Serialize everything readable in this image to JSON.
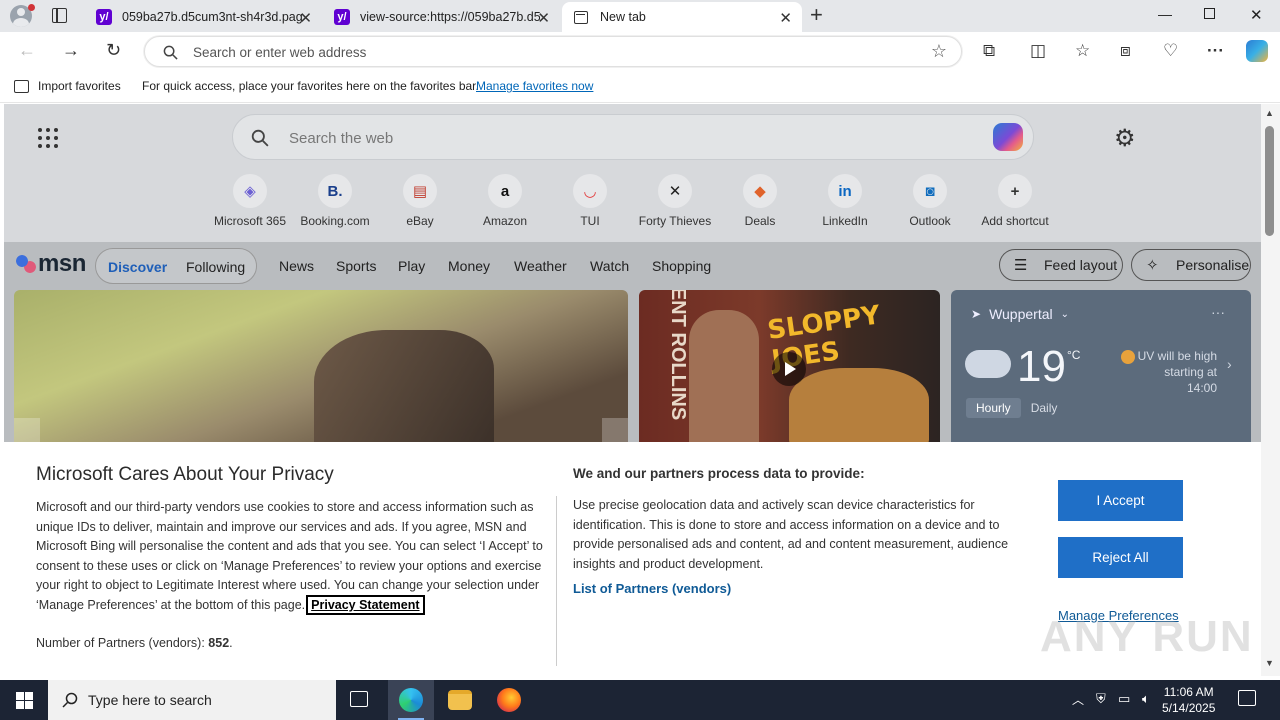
{
  "tabs": [
    {
      "title": "059ba27b.d5cum3nt-sh4r3d.pag"
    },
    {
      "title": "view-source:https://059ba27b.d5"
    },
    {
      "title": "New tab"
    }
  ],
  "address": {
    "placeholder": "Search or enter web address"
  },
  "favbar": {
    "import_label": "Import favorites",
    "message": "For quick access, place your favorites here on the favorites bar.",
    "manage_link": "Manage favorites now"
  },
  "newtab": {
    "search_placeholder": "Search the web",
    "shortcuts": [
      {
        "label": "Microsoft 365",
        "icon": "microsoft-365-icon",
        "glyph": "◈",
        "color": "#6b5fd3"
      },
      {
        "label": "Booking.com",
        "icon": "booking-icon",
        "glyph": "B.",
        "color": "#1a3f8c"
      },
      {
        "label": "eBay",
        "icon": "ebay-icon",
        "glyph": "▤",
        "color": "#c0392b"
      },
      {
        "label": "Amazon",
        "icon": "amazon-icon",
        "glyph": "a",
        "color": "#111111"
      },
      {
        "label": "TUI",
        "icon": "tui-icon",
        "glyph": "◡",
        "color": "#e23a3a"
      },
      {
        "label": "Forty Thieves",
        "icon": "forty-thieves-icon",
        "glyph": "✕",
        "color": "#222222"
      },
      {
        "label": "Deals",
        "icon": "deals-icon",
        "glyph": "◆",
        "color": "#e0632b"
      },
      {
        "label": "LinkedIn",
        "icon": "linkedin-icon",
        "glyph": "in",
        "color": "#0a66c2"
      },
      {
        "label": "Outlook",
        "icon": "outlook-icon",
        "glyph": "◙",
        "color": "#0f6cbd"
      },
      {
        "label": "Add shortcut",
        "icon": "plus-icon",
        "glyph": "+",
        "color": "#333333"
      }
    ],
    "msn_logo": "msn",
    "pill_tabs": [
      "Discover",
      "Following"
    ],
    "nav_items": [
      "News",
      "Sports",
      "Play",
      "Money",
      "Weather",
      "Watch",
      "Shopping"
    ],
    "feed_layout": "Feed layout",
    "personalise": "Personalise",
    "video_title": "SLOPPY JOES",
    "video_side_text": "ENT ROLLINS",
    "weather": {
      "location": "Wuppertal",
      "temp": "19",
      "unit": "°C",
      "uv": "UV will be high starting at 14:00",
      "tab_hourly": "Hourly",
      "tab_daily": "Daily"
    }
  },
  "privacy": {
    "title": "Microsoft Cares About Your Privacy",
    "body": "Microsoft and our third-party vendors use cookies to store and access information such as unique IDs to deliver, maintain and improve our services and ads. If you agree, MSN and Microsoft Bing will personalise the content and ads that you see. You can select ‘I Accept’ to consent to these uses or click on ‘Manage Preferences’ to review your options and exercise your right to object to Legitimate Interest where used. You can change your selection under ‘Manage Preferences’ at the bottom of this page.",
    "statement_link": "Privacy Statement",
    "partners_label": "Number of Partners (vendors):",
    "partners_count": "852",
    "partners_suffix": ".",
    "process_title": "We and our partners process data to provide:",
    "process_desc": "Use precise geolocation data and actively scan device characteristics for identification. This is done to store and access information on a device and to provide personalised ads and content, ad and content measurement, audience insights and product development.",
    "list_link": "List of Partners (vendors)",
    "accept": "I Accept",
    "reject": "Reject All",
    "manage": "Manage Preferences"
  },
  "watermark": "ANY RUN",
  "taskbar": {
    "search_placeholder": "Type here to search",
    "time": "11:06 AM",
    "date": "5/14/2025"
  },
  "colors": {
    "accent": "#1f6fc7",
    "link": "#0f5a96",
    "taskbar": "#1c2434"
  }
}
